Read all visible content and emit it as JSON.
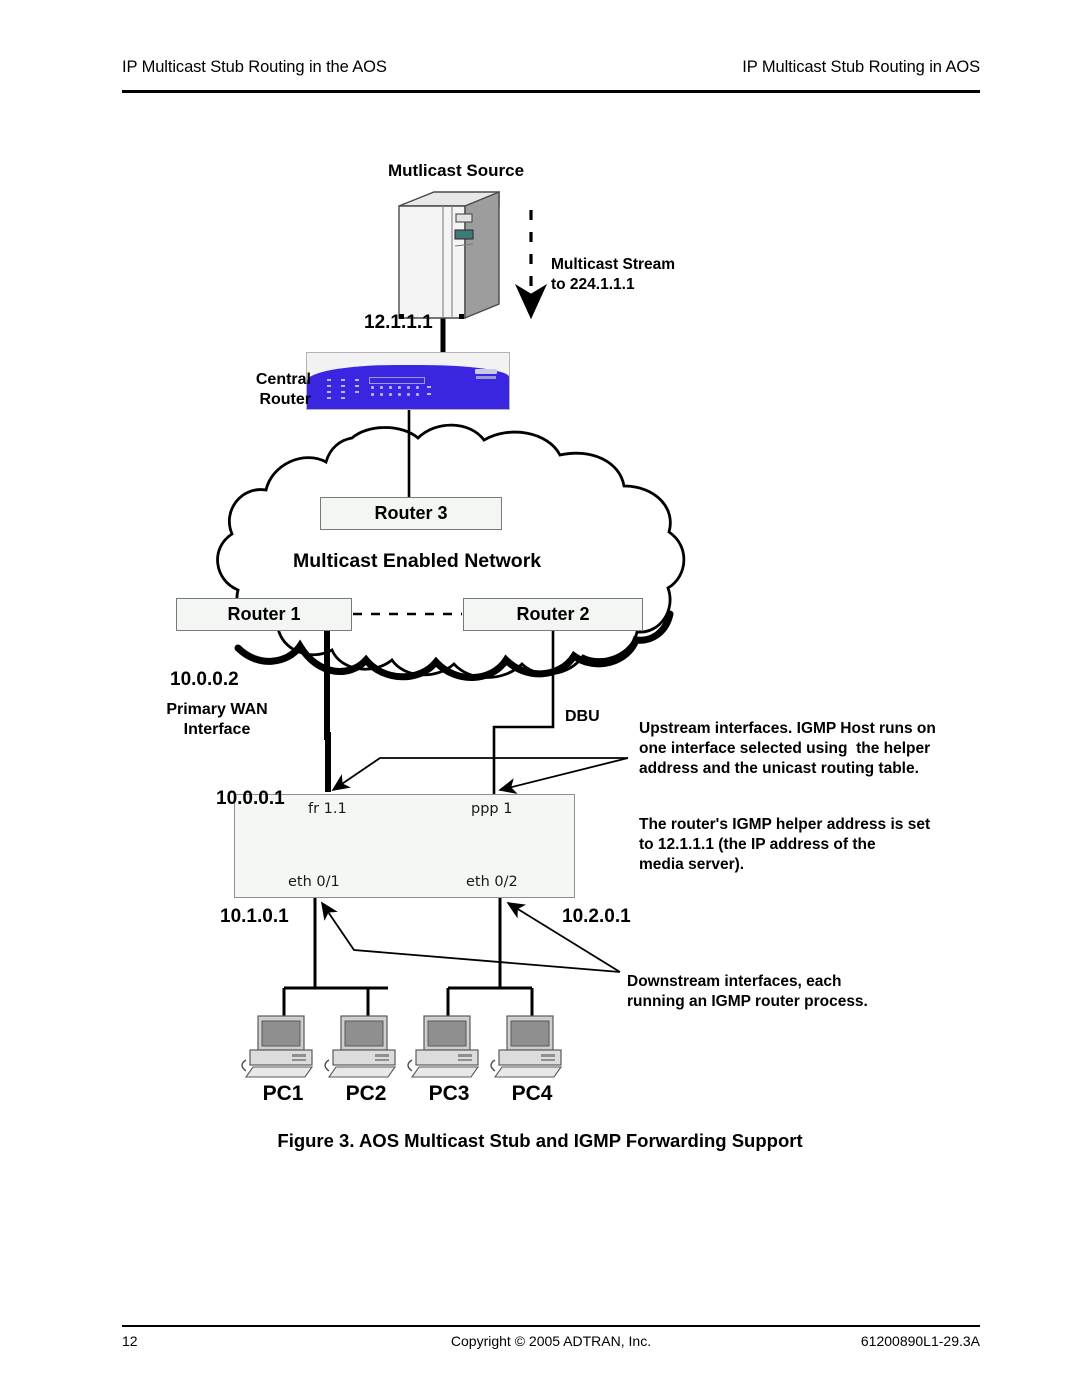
{
  "header": {
    "left": "IP Multicast Stub Routing in the AOS",
    "right": "IP Multicast Stub Routing in AOS"
  },
  "footer": {
    "page_number": "12",
    "copyright": "Copyright © 2005 ADTRAN, Inc.",
    "doc_number": "61200890L1-29.3A"
  },
  "figure": {
    "caption": "Figure 3.  AOS Multicast Stub and IGMP Forwarding Support"
  },
  "diagram": {
    "source_title": "Mutlicast Source",
    "stream_label": "Multicast Stream\nto 224.1.1.1",
    "source_ip": "12.1.1.1",
    "central_router_label": "Central\nRouter",
    "cloud_label": "Multicast Enabled Network",
    "routers": [
      {
        "name": "Router 3"
      },
      {
        "name": "Router 1"
      },
      {
        "name": "Router 2"
      }
    ],
    "wan_ip": "10.0.0.2",
    "wan_label": "Primary WAN\nInterface",
    "dbu_label": "DBU",
    "stub_wan_ip": "10.0.0.1",
    "stub_eth1_ip": "10.1.0.1",
    "stub_eth2_ip": "10.2.0.1",
    "ports": {
      "upper_left": "fr 1.1",
      "upper_right": "ppp 1",
      "lower_left": "eth 0/1",
      "lower_right": "eth 0/2"
    },
    "annotations": {
      "upstream": "Upstream interfaces. IGMP Host runs on\none interface selected using  the helper\naddress and the unicast routing table.",
      "helper": "The router's IGMP helper address is set\nto 12.1.1.1 (the IP address of the\nmedia server).",
      "downstream": "Downstream interfaces, each\nrunning an IGMP router process."
    },
    "pcs": [
      {
        "label": "PC1"
      },
      {
        "label": "PC2"
      },
      {
        "label": "PC3"
      },
      {
        "label": "PC4"
      }
    ]
  },
  "colors": {
    "router_blue": "#3a26e0",
    "box_fill": "#f4f6f4",
    "line": "#000000"
  }
}
